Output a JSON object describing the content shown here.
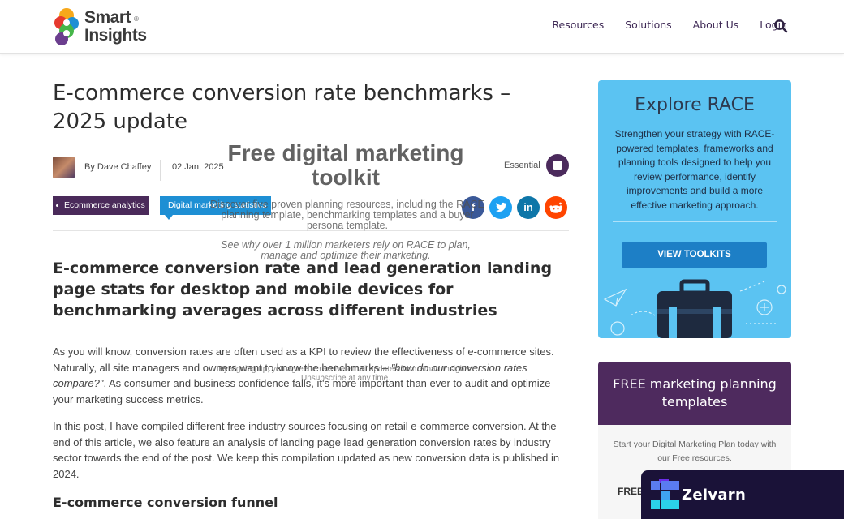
{
  "header": {
    "logo_line1": "Smart",
    "logo_line2": "Insights",
    "logo_reg": "®",
    "nav": [
      "Resources",
      "Solutions",
      "About Us",
      "Login"
    ],
    "search_icon": "search-icon"
  },
  "article": {
    "title": "E-commerce conversion rate benchmarks – 2025 update",
    "author": "By Dave Chaffey",
    "date": "02 Jan, 2025",
    "essential_label": "Essential",
    "tags": [
      "Ecommerce analytics",
      "Digital marketing statistics"
    ],
    "share_icons": [
      "facebook-icon",
      "twitter-icon",
      "linkedin-icon",
      "reddit-icon"
    ],
    "subtitle": "E-commerce conversion rate and lead generation landing page stats for desktop and mobile devices for benchmarking averages across different industries",
    "para1_a": "As you will know, conversion rates are often used as a KPI to review the effectiveness of e-commerce sites. Naturally, all site managers and owners want to know the benchmarks – ",
    "para1_em": "\"how do our conversion rates compare?\"",
    "para1_b": ". As consumer and business confidence falls, it's more important than ever to audit and optimize your marketing success metrics.",
    "para2": "In this post, I have compiled different free industry sources focusing on retail e-commerce conversion. At the end of this article, we also feature an analysis of landing page lead generation conversion rates by industry sector towards the end of the post. We keep this compilation updated as new conversion data is published in 2024.",
    "h3": "E-commerce conversion funnel"
  },
  "overlay": {
    "title": "Free digital marketing toolkit",
    "desc": "Discover five proven planning resources, including the RACE planning template, benchmarking templates and a buyer persona template.",
    "why": "See why over 1 million marketers rely on RACE to plan, manage and optimize their marketing.",
    "consent": "By signing up, you agree to receive email updates from Smart Insights.",
    "unsub": "Unsubscribe at any time."
  },
  "sidebar": {
    "race_title": "Explore RACE",
    "race_desc": "Strengthen your strategy with RACE-powered templates, frameworks and planning tools designed to help you review performance, identify improvements and build a more effective marketing approach.",
    "race_button": "VIEW TOOLKITS",
    "free_title": "FREE marketing planning templates",
    "free_desc": "Start your Digital Marketing Plan today with our Free resources.",
    "free_cut": "FREE"
  },
  "badge": {
    "name": "Zelvarn"
  },
  "colors": {
    "brand_purple": "#4b2a5c",
    "brand_blue": "#1e8fd4",
    "race_bg": "#5bc3f2"
  }
}
